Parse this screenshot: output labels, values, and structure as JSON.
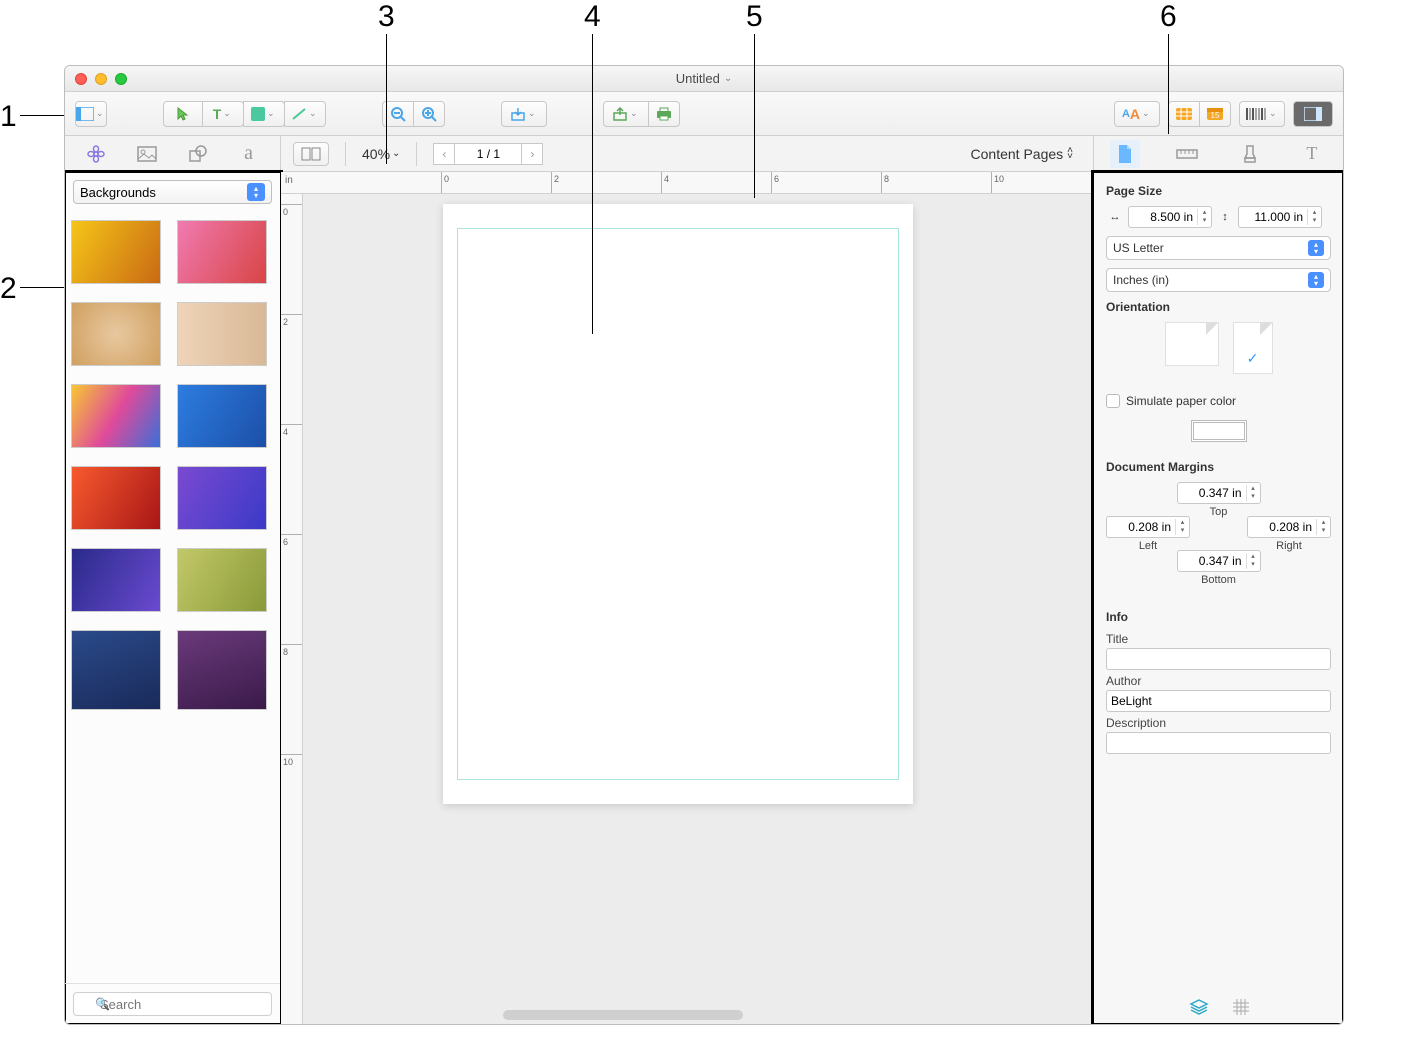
{
  "callouts": {
    "n1": "1",
    "n2": "2",
    "n3": "3",
    "n4": "4",
    "n5": "5",
    "n6": "6"
  },
  "window": {
    "title": "Untitled"
  },
  "toolbar": {
    "zoom_out": "−",
    "zoom_in": "+"
  },
  "secbar": {
    "zoom_value": "40%",
    "page_indicator": "1 / 1",
    "content_pages": "Content Pages"
  },
  "ruler": {
    "unit": "in",
    "h": [
      "0",
      "2",
      "4",
      "6",
      "8",
      "10"
    ],
    "v": [
      "0",
      "2",
      "4",
      "6",
      "8",
      "10"
    ]
  },
  "leftpanel": {
    "category": "Backgrounds",
    "search_placeholder": "Search"
  },
  "inspector": {
    "page_size_h": "Page Size",
    "width": "8.500 in",
    "height": "11.000 in",
    "preset": "US Letter",
    "units": "Inches (in)",
    "orientation_h": "Orientation",
    "simulate_label": "Simulate paper color",
    "margins_h": "Document Margins",
    "margin_top": "0.347 in",
    "margin_top_lbl": "Top",
    "margin_left": "0.208 in",
    "margin_left_lbl": "Left",
    "margin_right": "0.208 in",
    "margin_right_lbl": "Right",
    "margin_bottom": "0.347 in",
    "margin_bottom_lbl": "Bottom",
    "info_h": "Info",
    "title_lbl": "Title",
    "title_val": "",
    "author_lbl": "Author",
    "author_val": "BeLight",
    "desc_lbl": "Description"
  }
}
